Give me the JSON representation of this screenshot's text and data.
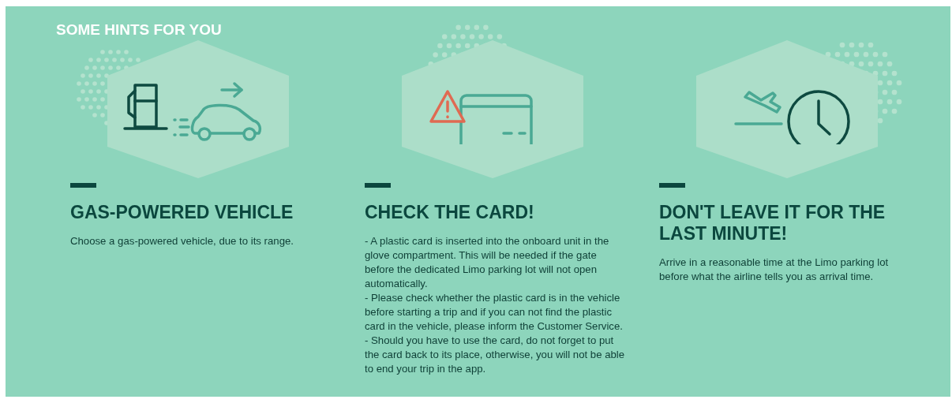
{
  "section": {
    "title": "SOME HINTS FOR YOU"
  },
  "hints": [
    {
      "kind": "fuel-car",
      "title": "GAS-POWERED VEHICLE",
      "paragraphs": [
        "Choose a gas-powered vehicle, due to its range."
      ]
    },
    {
      "kind": "card-warning",
      "title": "CHECK THE CARD!",
      "paragraphs": [
        "- A plastic card is inserted into the onboard unit in the glove compartment. This will be needed if the gate before the dedicated Limo parking lot will not open automatically.",
        "- Please check whether the plastic card is in the vehicle before starting a trip and if you can not find the plastic card in the vehicle, please inform the Customer Service.",
        "- Should you have to use the card, do not forget to put the card back to its place, otherwise, you will not be able to end your trip in the app."
      ]
    },
    {
      "kind": "plane-clock",
      "title": "DON'T LEAVE IT FOR THE LAST MINUTE!",
      "paragraphs": [
        "Arrive in a reasonable time at the Limo parking lot before what the airline tells you as arrival time."
      ]
    }
  ]
}
